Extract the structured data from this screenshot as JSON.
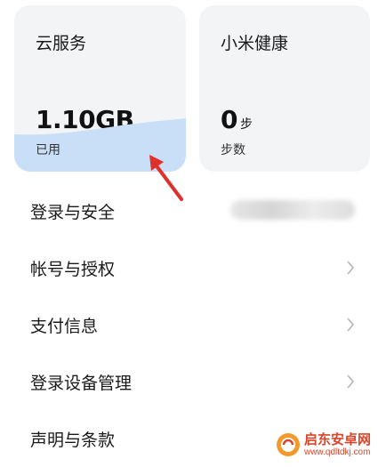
{
  "cards": {
    "cloud": {
      "title": "云服务",
      "value": "1.10GB",
      "subtitle": "已用",
      "fill_color": "#c8dff7"
    },
    "health": {
      "title": "小米健康",
      "value": "0",
      "unit": "步",
      "subtitle": "步数"
    }
  },
  "menu": {
    "items": [
      {
        "label": "登录与安全"
      },
      {
        "label": "帐号与授权"
      },
      {
        "label": "支付信息"
      },
      {
        "label": "登录设备管理"
      },
      {
        "label": "声明与条款"
      }
    ]
  },
  "annotation": {
    "arrow_color": "#e0302a"
  },
  "watermark": {
    "name": "启东安卓网",
    "url": "www.qdltdkj.com",
    "color": "#d9452b"
  }
}
